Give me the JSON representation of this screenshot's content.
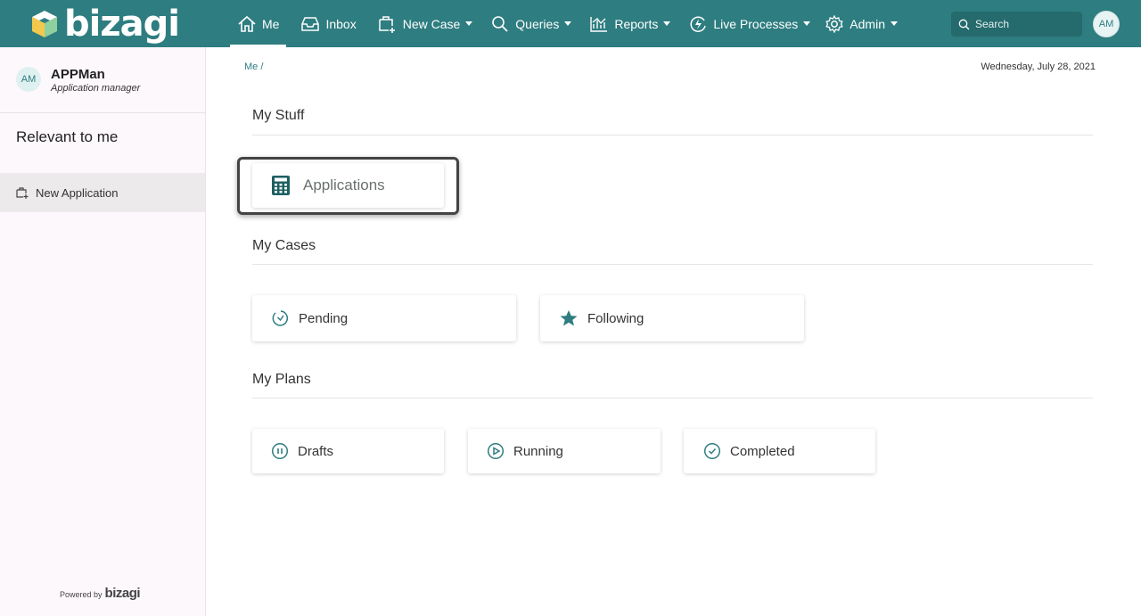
{
  "brand": {
    "name": "bizagi",
    "accent": "#2e7d80"
  },
  "nav": {
    "me": "Me",
    "inbox": "Inbox",
    "new_case": "New Case",
    "queries": "Queries",
    "reports": "Reports",
    "live_processes": "Live Processes",
    "admin": "Admin"
  },
  "search": {
    "placeholder": "Search"
  },
  "user": {
    "initials": "AM",
    "name": "APPMan",
    "role": "Application manager"
  },
  "sidebar": {
    "heading": "Relevant to me",
    "items": [
      {
        "label": "New Application",
        "icon": "new-case-icon"
      }
    ],
    "powered_by": "Powered by",
    "powered_brand": "bizagi"
  },
  "breadcrumb": "Me /",
  "date": "Wednesday, July 28, 2021",
  "sections": {
    "my_stuff": {
      "title": "My Stuff",
      "cards": [
        {
          "label": "Applications",
          "icon": "calculator-icon"
        }
      ]
    },
    "my_cases": {
      "title": "My Cases",
      "cards": [
        {
          "label": "Pending",
          "icon": "clock-icon"
        },
        {
          "label": "Following",
          "icon": "star-icon"
        }
      ]
    },
    "my_plans": {
      "title": "My Plans",
      "cards": [
        {
          "label": "Drafts",
          "icon": "pause-icon"
        },
        {
          "label": "Running",
          "icon": "play-icon"
        },
        {
          "label": "Completed",
          "icon": "check-icon"
        }
      ]
    }
  }
}
